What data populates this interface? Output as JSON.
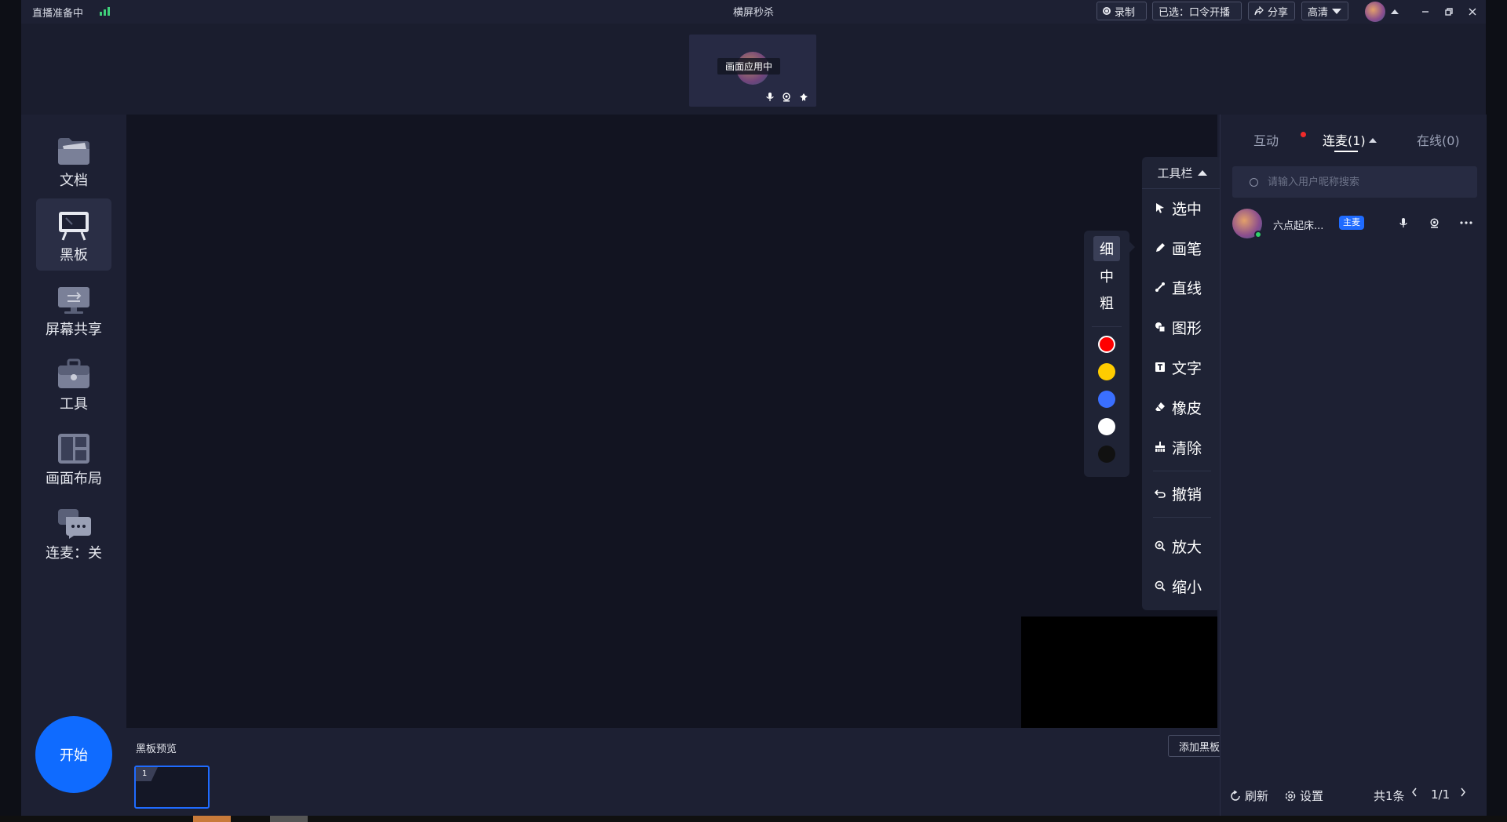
{
  "titlebar": {
    "status": "直播准备中",
    "app_title": "横屏秒杀",
    "record_label": "录制",
    "selected_label": "已选：口令开播",
    "share_label": "分享",
    "quality_label": "高清"
  },
  "video": {
    "label": "画面应用中"
  },
  "sidebar": {
    "items": [
      {
        "label": "文档",
        "icon": "folder-icon"
      },
      {
        "label": "黑板",
        "icon": "blackboard-icon"
      },
      {
        "label": "屏幕共享",
        "icon": "monitor-icon"
      },
      {
        "label": "工具",
        "icon": "toolbox-icon"
      },
      {
        "label": "画面布局",
        "icon": "layout-icon"
      },
      {
        "label": "连麦：关",
        "icon": "chat-icon"
      }
    ],
    "start_label": "开始"
  },
  "toolbar": {
    "header": "工具栏",
    "tools": [
      "选中",
      "画笔",
      "直线",
      "图形",
      "文字",
      "橡皮",
      "清除",
      "撤销",
      "放大",
      "缩小"
    ]
  },
  "pen": {
    "sizes": [
      "细",
      "中",
      "粗"
    ],
    "selected_size": "细",
    "colors": [
      "#ff0000",
      "#ffcc00",
      "#3a6fff",
      "#ffffff",
      "#111111"
    ],
    "selected_color": "#ff0000"
  },
  "preview": {
    "title": "黑板预览",
    "add_label": "添加黑板",
    "page_number": "1"
  },
  "right": {
    "tabs": {
      "interact": "互动",
      "mic": "连麦(1)",
      "online": "在线(0)"
    },
    "search_placeholder": "请输入用户昵称搜索",
    "user": {
      "name": "六点起床...",
      "badge": "主麦"
    },
    "footer": {
      "refresh": "刷新",
      "settings": "设置",
      "total": "共1条",
      "page": "1/1"
    }
  }
}
